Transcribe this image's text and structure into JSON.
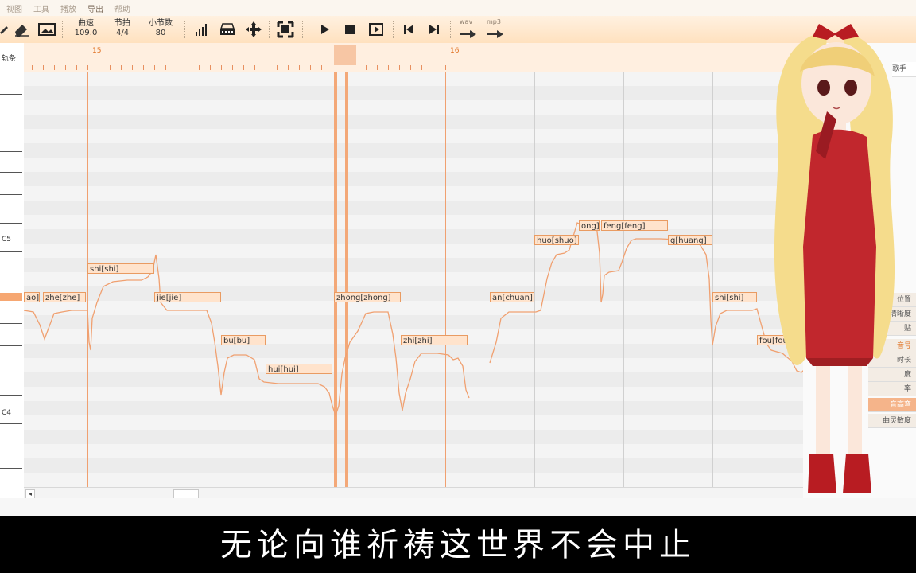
{
  "menu": {
    "items": [
      "视图",
      "工具",
      "播放",
      "导出",
      "帮助"
    ]
  },
  "toolbar": {
    "tempo_label": "曲速",
    "tempo_value": "109.0",
    "beat_label": "节拍",
    "beat_value": "4/4",
    "bars_label": "小节数",
    "bars_value": "80",
    "wav_label": "wav",
    "mp3_label": "mp3"
  },
  "sidebar": {
    "header": "轨条",
    "c5": "C5",
    "c4": "C4"
  },
  "ruler": {
    "bar_15": "15",
    "bar_16": "16"
  },
  "notes": [
    "ao]",
    "zhe[zhe]",
    "shi[shi]",
    "jie[jie]",
    "bu[bu]",
    "hui[hui]",
    "zhong[zhong]",
    "zhi[zhi]",
    "an[chuan]",
    "huo[shuo]",
    "ong]",
    "feng[feng]",
    "g[huang]",
    "shi[shi]",
    "fou[fou]"
  ],
  "right_panel": {
    "top_tab": "歌手",
    "items": [
      "位置",
      "清晰度",
      "贴",
      "音号",
      "时长",
      "度",
      "率",
      "音高弯",
      "曲灵敏度"
    ]
  },
  "subtitle": "无论向谁祈祷这世界不会中止",
  "colors": {
    "accent": "#f08040",
    "toolbar": "#ffe6c8",
    "subtitle_bg": "#000000"
  }
}
